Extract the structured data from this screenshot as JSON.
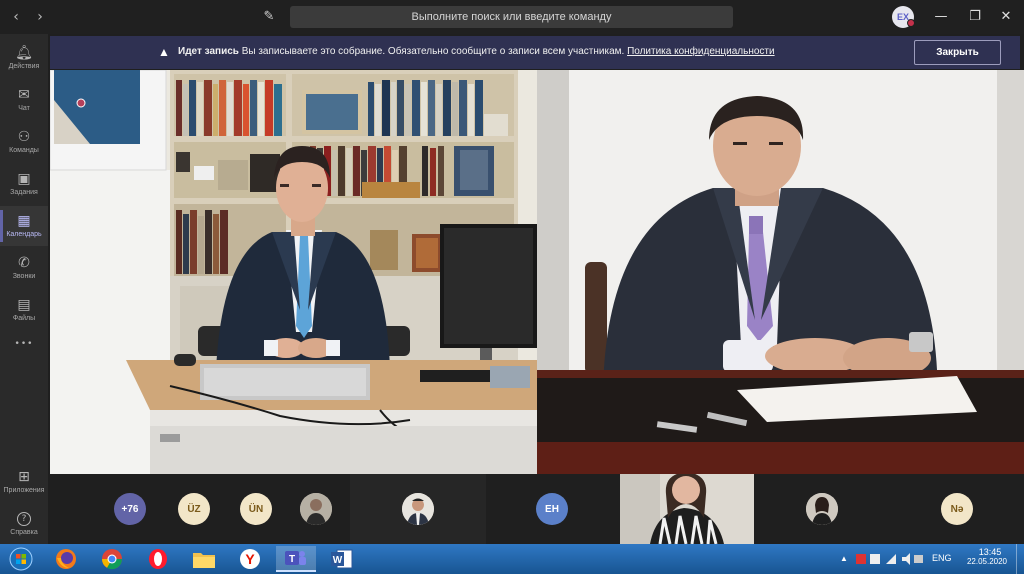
{
  "titlebar": {
    "search_placeholder": "Выполните поиск или введите команду",
    "avatar_initials": "EX",
    "back_glyph": "‹",
    "forward_glyph": "›",
    "compose_glyph": "✎",
    "minimize_glyph": "—",
    "maximize_glyph": "❐",
    "close_glyph": "✕"
  },
  "rail": {
    "items": [
      {
        "label": "Действия",
        "icon": "bell-icon",
        "glyph": "🔔︎"
      },
      {
        "label": "Чат",
        "icon": "chat-icon",
        "glyph": "✉"
      },
      {
        "label": "Команды",
        "icon": "teams-icon",
        "glyph": "⚇"
      },
      {
        "label": "Задания",
        "icon": "assignments-icon",
        "glyph": "▣"
      },
      {
        "label": "Календарь",
        "icon": "calendar-icon",
        "glyph": "▦"
      },
      {
        "label": "Звонки",
        "icon": "phone-icon",
        "glyph": "✆"
      },
      {
        "label": "Файлы",
        "icon": "file-icon",
        "glyph": "▤"
      },
      {
        "label": "",
        "icon": "more-icon",
        "glyph": "•••"
      }
    ],
    "bottom": [
      {
        "label": "Приложения",
        "icon": "apps-icon",
        "glyph": "⊞"
      },
      {
        "label": "Справка",
        "icon": "help-icon",
        "glyph": "?"
      }
    ]
  },
  "banner": {
    "title": "Идет запись",
    "message": " Вы записываете это собрание. Обязательно сообщите о записи всем участникам. ",
    "link": "Политика конфиденциальности",
    "close_label": "Закрыть"
  },
  "participants": [
    {
      "type": "initials",
      "text": "+76",
      "style": "purple"
    },
    {
      "type": "initials",
      "text": "ÜZ",
      "style": "light"
    },
    {
      "type": "initials",
      "text": "ÜN",
      "style": "light"
    },
    {
      "type": "photo",
      "text": ""
    },
    {
      "type": "photo",
      "text": ""
    },
    {
      "type": "initials",
      "text": "EH",
      "style": "blue"
    },
    {
      "type": "video",
      "text": ""
    },
    {
      "type": "photo",
      "text": ""
    },
    {
      "type": "initials",
      "text": "Nə",
      "style": "light"
    }
  ],
  "taskbar": {
    "apps": [
      "start-orb",
      "firefox",
      "chrome",
      "opera",
      "explorer",
      "yandex",
      "teams",
      "word"
    ],
    "active_app": "teams",
    "language": "ENG",
    "time": "13:45",
    "date": "22.05.2020"
  },
  "colors": {
    "teams_purple": "#6264a7",
    "banner_bg": "#2f3152",
    "taskbar_blue": "#2f78c4"
  }
}
